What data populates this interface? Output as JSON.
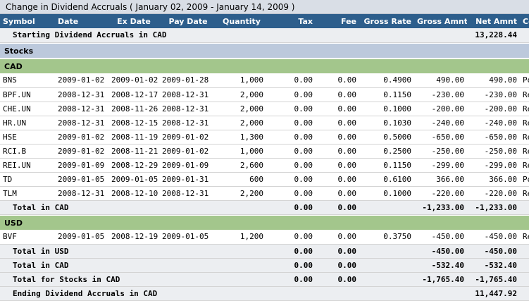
{
  "title": "Change in Dividend Accruals ( January 02, 2009 - January 14, 2009 )",
  "columns": [
    "Symbol",
    "Date",
    "Ex Date",
    "Pay Date",
    "Quantity",
    "Tax",
    "Fee",
    "Gross Rate",
    "Gross Amnt",
    "Net Amnt",
    "Code"
  ],
  "starting": {
    "label": "Starting Dividend Accruals in CAD",
    "net": "13,228.44"
  },
  "section_label": "Stocks",
  "cad": {
    "label": "CAD",
    "rows": [
      [
        "BNS",
        "2009-01-02",
        "2009-01-02",
        "2009-01-28",
        "1,000",
        "0.00",
        "0.00",
        "0.4900",
        "490.00",
        "490.00",
        "Po"
      ],
      [
        "BPF.UN",
        "2008-12-31",
        "2008-12-17",
        "2008-12-31",
        "2,000",
        "0.00",
        "0.00",
        "0.1150",
        "-230.00",
        "-230.00",
        "Re"
      ],
      [
        "CHE.UN",
        "2008-12-31",
        "2008-11-26",
        "2008-12-31",
        "2,000",
        "0.00",
        "0.00",
        "0.1000",
        "-200.00",
        "-200.00",
        "Re"
      ],
      [
        "HR.UN",
        "2008-12-31",
        "2008-12-15",
        "2008-12-31",
        "2,000",
        "0.00",
        "0.00",
        "0.1030",
        "-240.00",
        "-240.00",
        "Re"
      ],
      [
        "HSE",
        "2009-01-02",
        "2008-11-19",
        "2009-01-02",
        "1,300",
        "0.00",
        "0.00",
        "0.5000",
        "-650.00",
        "-650.00",
        "Re"
      ],
      [
        "RCI.B",
        "2009-01-02",
        "2008-11-21",
        "2009-01-02",
        "1,000",
        "0.00",
        "0.00",
        "0.2500",
        "-250.00",
        "-250.00",
        "Re"
      ],
      [
        "REI.UN",
        "2009-01-09",
        "2008-12-29",
        "2009-01-09",
        "2,600",
        "0.00",
        "0.00",
        "0.1150",
        "-299.00",
        "-299.00",
        "Re"
      ],
      [
        "TD",
        "2009-01-05",
        "2009-01-05",
        "2009-01-31",
        "600",
        "0.00",
        "0.00",
        "0.6100",
        "366.00",
        "366.00",
        "Po"
      ],
      [
        "TLM",
        "2008-12-31",
        "2008-12-10",
        "2008-12-31",
        "2,200",
        "0.00",
        "0.00",
        "0.1000",
        "-220.00",
        "-220.00",
        "Re"
      ]
    ],
    "total": {
      "label": "Total in CAD",
      "tax": "0.00",
      "fee": "0.00",
      "gross": "-1,233.00",
      "net": "-1,233.00"
    }
  },
  "usd": {
    "label": "USD",
    "rows": [
      [
        "BVF",
        "2009-01-05",
        "2008-12-19",
        "2009-01-05",
        "1,200",
        "0.00",
        "0.00",
        "0.3750",
        "-450.00",
        "-450.00",
        "Re"
      ]
    ],
    "total": {
      "label": "Total in USD",
      "tax": "0.00",
      "fee": "0.00",
      "gross": "-450.00",
      "net": "-450.00"
    },
    "total_cad": {
      "label": "Total in CAD",
      "tax": "0.00",
      "fee": "0.00",
      "gross": "-532.40",
      "net": "-532.40"
    }
  },
  "stocks_total": {
    "label": "Total for Stocks in CAD",
    "tax": "0.00",
    "fee": "0.00",
    "gross": "-1,765.40",
    "net": "-1,765.40"
  },
  "ending": {
    "label": "Ending Dividend Accruals in CAD",
    "net": "11,447.92"
  }
}
